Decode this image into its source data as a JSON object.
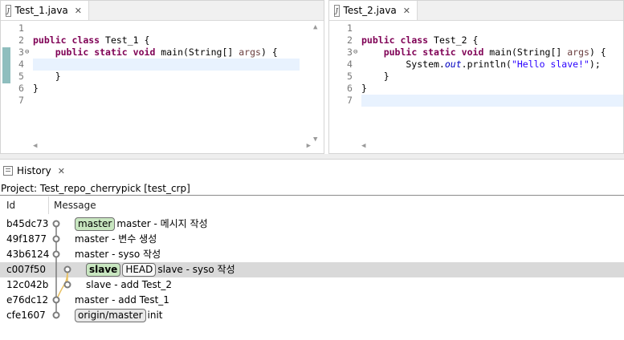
{
  "editors": [
    {
      "tab_title": "Test_1.java",
      "line_numbers": [
        "1",
        "2",
        "3",
        "4",
        "5",
        "6",
        "7"
      ],
      "lines": [
        [],
        [
          {
            "t": "public",
            "c": "kw"
          },
          {
            "t": " "
          },
          {
            "t": "class",
            "c": "kw"
          },
          {
            "t": " Test_1 {"
          }
        ],
        [
          {
            "t": "    "
          },
          {
            "t": "public",
            "c": "kw"
          },
          {
            "t": " "
          },
          {
            "t": "static",
            "c": "kw"
          },
          {
            "t": " "
          },
          {
            "t": "void",
            "c": "kw"
          },
          {
            "t": " main(String[] "
          },
          {
            "t": "args",
            "c": "var"
          },
          {
            "t": ") {"
          }
        ],
        [],
        [
          {
            "t": "    }"
          }
        ],
        [
          {
            "t": "}"
          }
        ],
        []
      ]
    },
    {
      "tab_title": "Test_2.java",
      "line_numbers": [
        "1",
        "2",
        "3",
        "4",
        "5",
        "6",
        "7"
      ],
      "lines": [
        [],
        [
          {
            "t": "public",
            "c": "kw"
          },
          {
            "t": " "
          },
          {
            "t": "class",
            "c": "kw"
          },
          {
            "t": " Test_2 {"
          }
        ],
        [
          {
            "t": "    "
          },
          {
            "t": "public",
            "c": "kw"
          },
          {
            "t": " "
          },
          {
            "t": "static",
            "c": "kw"
          },
          {
            "t": " "
          },
          {
            "t": "void",
            "c": "kw"
          },
          {
            "t": " main(String[] "
          },
          {
            "t": "args",
            "c": "var"
          },
          {
            "t": ") {"
          }
        ],
        [
          {
            "t": "        System."
          },
          {
            "t": "out",
            "c": "fld"
          },
          {
            "t": ".println("
          },
          {
            "t": "\"Hello slave!\"",
            "c": "str"
          },
          {
            "t": ");"
          }
        ],
        [
          {
            "t": "    }"
          }
        ],
        [
          {
            "t": "}"
          }
        ],
        []
      ]
    }
  ],
  "history": {
    "tab_title": "History",
    "project_line": "Project: Test_repo_cherrypick [test_crp]",
    "columns": {
      "id": "Id",
      "message": "Message"
    },
    "commits": [
      {
        "id": "b45dc73",
        "refs": [
          {
            "label": "master",
            "style": "green"
          }
        ],
        "message": "master - 메시지 작성"
      },
      {
        "id": "49f1877",
        "refs": [],
        "message": "master - 변수 생성"
      },
      {
        "id": "43b6124",
        "refs": [],
        "message": "master - syso 작성"
      },
      {
        "id": "c007f50",
        "refs": [
          {
            "label": "slave",
            "style": "green-bold"
          },
          {
            "label": "HEAD",
            "style": "plain"
          }
        ],
        "message": "slave - syso 작성"
      },
      {
        "id": "12c042b",
        "refs": [],
        "message": "slave - add Test_2"
      },
      {
        "id": "e76dc12",
        "refs": [],
        "message": "master - add Test_1"
      },
      {
        "id": "cfe1607",
        "refs": [
          {
            "label": "origin/master",
            "style": "remote"
          }
        ],
        "message": "init"
      }
    ]
  },
  "colors": {
    "keyword": "#7f0055",
    "string": "#2a00ff",
    "selection": "#d9d9d9",
    "branch_green": "#c8e6c0",
    "graph_line": "#e8c060"
  }
}
